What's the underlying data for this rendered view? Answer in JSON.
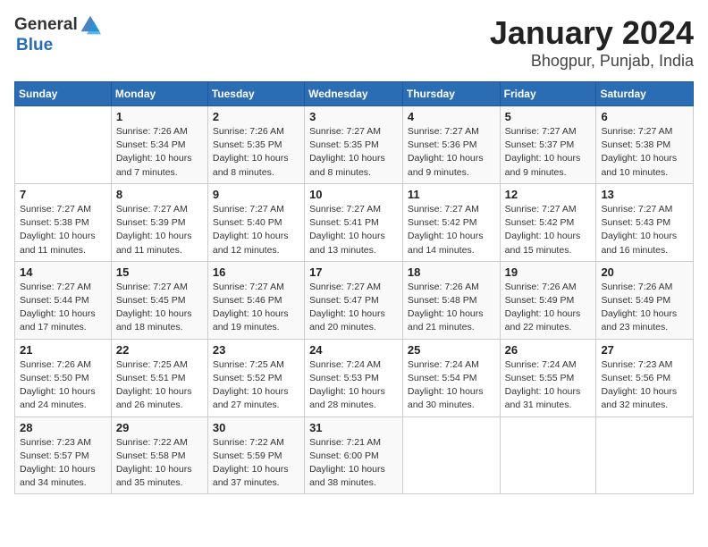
{
  "header": {
    "logo_general": "General",
    "logo_blue": "Blue",
    "month": "January 2024",
    "location": "Bhogpur, Punjab, India"
  },
  "days_of_week": [
    "Sunday",
    "Monday",
    "Tuesday",
    "Wednesday",
    "Thursday",
    "Friday",
    "Saturday"
  ],
  "weeks": [
    [
      {
        "day": "",
        "sunrise": "",
        "sunset": "",
        "daylight": ""
      },
      {
        "day": "1",
        "sunrise": "Sunrise: 7:26 AM",
        "sunset": "Sunset: 5:34 PM",
        "daylight": "Daylight: 10 hours and 7 minutes."
      },
      {
        "day": "2",
        "sunrise": "Sunrise: 7:26 AM",
        "sunset": "Sunset: 5:35 PM",
        "daylight": "Daylight: 10 hours and 8 minutes."
      },
      {
        "day": "3",
        "sunrise": "Sunrise: 7:27 AM",
        "sunset": "Sunset: 5:35 PM",
        "daylight": "Daylight: 10 hours and 8 minutes."
      },
      {
        "day": "4",
        "sunrise": "Sunrise: 7:27 AM",
        "sunset": "Sunset: 5:36 PM",
        "daylight": "Daylight: 10 hours and 9 minutes."
      },
      {
        "day": "5",
        "sunrise": "Sunrise: 7:27 AM",
        "sunset": "Sunset: 5:37 PM",
        "daylight": "Daylight: 10 hours and 9 minutes."
      },
      {
        "day": "6",
        "sunrise": "Sunrise: 7:27 AM",
        "sunset": "Sunset: 5:38 PM",
        "daylight": "Daylight: 10 hours and 10 minutes."
      }
    ],
    [
      {
        "day": "7",
        "sunrise": "Sunrise: 7:27 AM",
        "sunset": "Sunset: 5:38 PM",
        "daylight": "Daylight: 10 hours and 11 minutes."
      },
      {
        "day": "8",
        "sunrise": "Sunrise: 7:27 AM",
        "sunset": "Sunset: 5:39 PM",
        "daylight": "Daylight: 10 hours and 11 minutes."
      },
      {
        "day": "9",
        "sunrise": "Sunrise: 7:27 AM",
        "sunset": "Sunset: 5:40 PM",
        "daylight": "Daylight: 10 hours and 12 minutes."
      },
      {
        "day": "10",
        "sunrise": "Sunrise: 7:27 AM",
        "sunset": "Sunset: 5:41 PM",
        "daylight": "Daylight: 10 hours and 13 minutes."
      },
      {
        "day": "11",
        "sunrise": "Sunrise: 7:27 AM",
        "sunset": "Sunset: 5:42 PM",
        "daylight": "Daylight: 10 hours and 14 minutes."
      },
      {
        "day": "12",
        "sunrise": "Sunrise: 7:27 AM",
        "sunset": "Sunset: 5:42 PM",
        "daylight": "Daylight: 10 hours and 15 minutes."
      },
      {
        "day": "13",
        "sunrise": "Sunrise: 7:27 AM",
        "sunset": "Sunset: 5:43 PM",
        "daylight": "Daylight: 10 hours and 16 minutes."
      }
    ],
    [
      {
        "day": "14",
        "sunrise": "Sunrise: 7:27 AM",
        "sunset": "Sunset: 5:44 PM",
        "daylight": "Daylight: 10 hours and 17 minutes."
      },
      {
        "day": "15",
        "sunrise": "Sunrise: 7:27 AM",
        "sunset": "Sunset: 5:45 PM",
        "daylight": "Daylight: 10 hours and 18 minutes."
      },
      {
        "day": "16",
        "sunrise": "Sunrise: 7:27 AM",
        "sunset": "Sunset: 5:46 PM",
        "daylight": "Daylight: 10 hours and 19 minutes."
      },
      {
        "day": "17",
        "sunrise": "Sunrise: 7:27 AM",
        "sunset": "Sunset: 5:47 PM",
        "daylight": "Daylight: 10 hours and 20 minutes."
      },
      {
        "day": "18",
        "sunrise": "Sunrise: 7:26 AM",
        "sunset": "Sunset: 5:48 PM",
        "daylight": "Daylight: 10 hours and 21 minutes."
      },
      {
        "day": "19",
        "sunrise": "Sunrise: 7:26 AM",
        "sunset": "Sunset: 5:49 PM",
        "daylight": "Daylight: 10 hours and 22 minutes."
      },
      {
        "day": "20",
        "sunrise": "Sunrise: 7:26 AM",
        "sunset": "Sunset: 5:49 PM",
        "daylight": "Daylight: 10 hours and 23 minutes."
      }
    ],
    [
      {
        "day": "21",
        "sunrise": "Sunrise: 7:26 AM",
        "sunset": "Sunset: 5:50 PM",
        "daylight": "Daylight: 10 hours and 24 minutes."
      },
      {
        "day": "22",
        "sunrise": "Sunrise: 7:25 AM",
        "sunset": "Sunset: 5:51 PM",
        "daylight": "Daylight: 10 hours and 26 minutes."
      },
      {
        "day": "23",
        "sunrise": "Sunrise: 7:25 AM",
        "sunset": "Sunset: 5:52 PM",
        "daylight": "Daylight: 10 hours and 27 minutes."
      },
      {
        "day": "24",
        "sunrise": "Sunrise: 7:24 AM",
        "sunset": "Sunset: 5:53 PM",
        "daylight": "Daylight: 10 hours and 28 minutes."
      },
      {
        "day": "25",
        "sunrise": "Sunrise: 7:24 AM",
        "sunset": "Sunset: 5:54 PM",
        "daylight": "Daylight: 10 hours and 30 minutes."
      },
      {
        "day": "26",
        "sunrise": "Sunrise: 7:24 AM",
        "sunset": "Sunset: 5:55 PM",
        "daylight": "Daylight: 10 hours and 31 minutes."
      },
      {
        "day": "27",
        "sunrise": "Sunrise: 7:23 AM",
        "sunset": "Sunset: 5:56 PM",
        "daylight": "Daylight: 10 hours and 32 minutes."
      }
    ],
    [
      {
        "day": "28",
        "sunrise": "Sunrise: 7:23 AM",
        "sunset": "Sunset: 5:57 PM",
        "daylight": "Daylight: 10 hours and 34 minutes."
      },
      {
        "day": "29",
        "sunrise": "Sunrise: 7:22 AM",
        "sunset": "Sunset: 5:58 PM",
        "daylight": "Daylight: 10 hours and 35 minutes."
      },
      {
        "day": "30",
        "sunrise": "Sunrise: 7:22 AM",
        "sunset": "Sunset: 5:59 PM",
        "daylight": "Daylight: 10 hours and 37 minutes."
      },
      {
        "day": "31",
        "sunrise": "Sunrise: 7:21 AM",
        "sunset": "Sunset: 6:00 PM",
        "daylight": "Daylight: 10 hours and 38 minutes."
      },
      {
        "day": "",
        "sunrise": "",
        "sunset": "",
        "daylight": ""
      },
      {
        "day": "",
        "sunrise": "",
        "sunset": "",
        "daylight": ""
      },
      {
        "day": "",
        "sunrise": "",
        "sunset": "",
        "daylight": ""
      }
    ]
  ]
}
